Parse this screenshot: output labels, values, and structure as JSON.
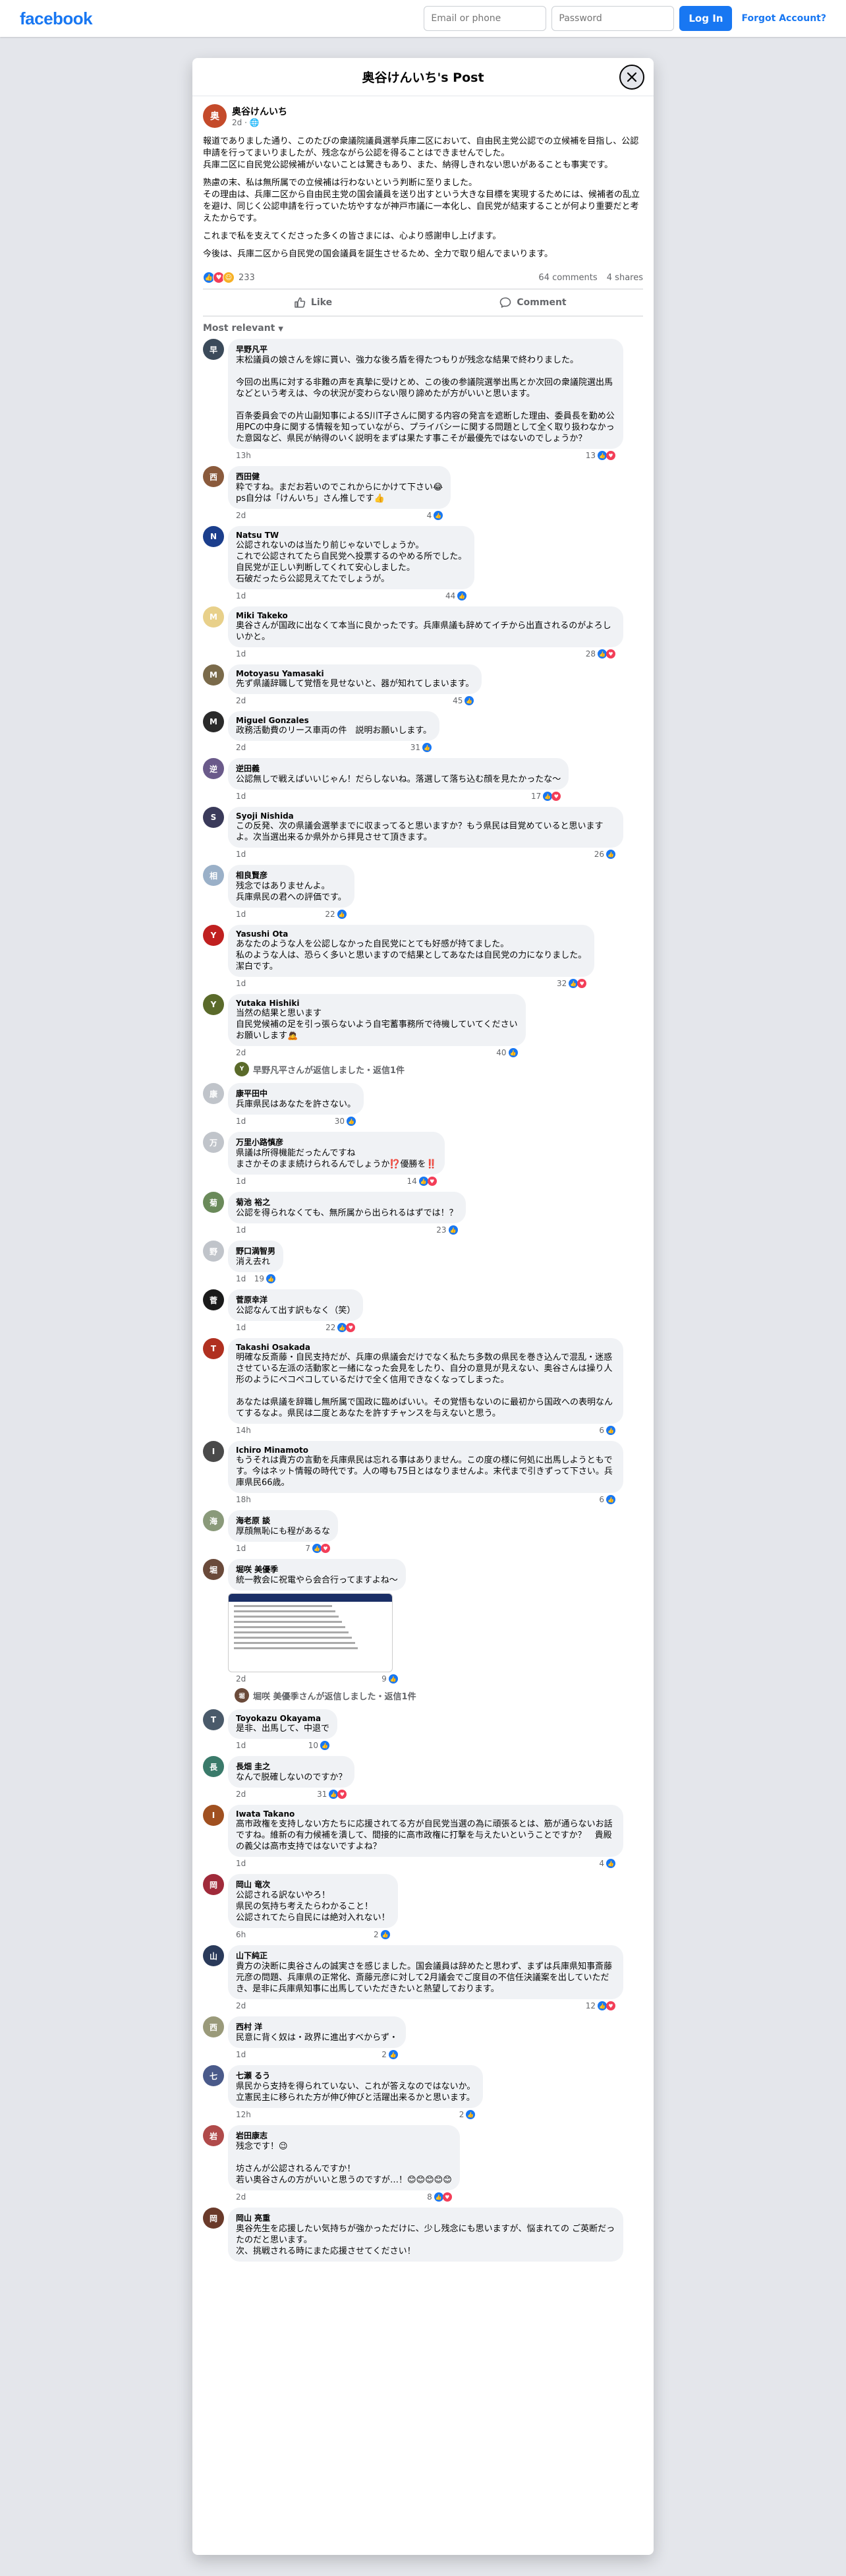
{
  "topbar": {
    "logo": "facebook",
    "email_placeholder": "Email or phone",
    "password_placeholder": "Password",
    "login_label": "Log In",
    "forgot_label": "Forgot Account?"
  },
  "dialog": {
    "title": "奥谷けんいち's Post"
  },
  "post": {
    "author": "奥谷けんいち",
    "time": "2d · ",
    "paragraphs": [
      "報道でありました通り、このたびの衆議院議員選挙兵庫二区において、自由民主党公認での立候補を目指し、公認申請を行ってまいりましたが、残念ながら公認を得ることはできませんでした。\n兵庫二区に自民党公認候補がいないことは驚きもあり、また、納得しきれない思いがあることも事実です。",
      "熟慮の末、私は無所属での立候補は行わないという判断に至りました。\nその理由は、兵庫二区から自由民主党の国会議員を送り出すという大きな目標を実現するためには、候補者の乱立を避け、同じく公認申請を行っていた坊やすなが神戸市議に一本化し、自民党が結束することが何より重要だと考えたからです。",
      "これまで私を支えてくださった多くの皆さまには、心より感謝申し上げます。",
      "今後は、兵庫二区から自民党の国会議員を誕生させるため、全力で取り組んでまいります。"
    ],
    "reaction_count": "233",
    "comments_count": "64 comments",
    "shares_count": "4 shares",
    "like_label": "Like",
    "comment_label": "Comment",
    "sort_label": "Most relevant"
  },
  "comments": [
    {
      "name": "早野凡平",
      "text": "末松議員の娘さんを嫁に貰い、強力な後ろ盾を得たつもりが残念な結果で終わりました。\n\n今回の出馬に対する非難の声を真摯に受けとめ、この後の参議院選挙出馬とか次回の衆議院選出馬などという考えは、今の状況が変わらない限り諦めたが方がいいと思います。\n\n百条委員会での片山副知事によるS川T子さんに関する内容の発言を遮断した理由、委員長を勤め公用PCの中身に関する情報を知っていながら、プライバシーに関する問題として全く取り扱わなかった意図など、県民が納得のいく説明をまずは果たす事こそが最優先ではないのでしょうか？",
      "time": "13h",
      "count": "13",
      "color": "#3b4a5a"
    },
    {
      "name": "西田健",
      "text": "粋ですね。まだお若いのでこれからにかけて下さい😂\nps自分は「けんいち」さん推しです👍",
      "time": "2d",
      "count": "4",
      "color": "#8a5a3c"
    },
    {
      "name": "Natsu TW",
      "text": "公認されないのは当たり前じゃないでしょうか。\nこれで公認されてたら自民党へ投票するのやめる所でした。\n自民党が正しい判断してくれて安心しました。\n石破だったら公認見えてたでしょうが。",
      "time": "1d",
      "count": "44",
      "color": "#1b3e8c"
    },
    {
      "name": "Miki Takeko",
      "text": "奥谷さんが国政に出なくて本当に良かったです。兵庫県議も辞めてイチから出直されるのがよろしいかと。",
      "time": "1d",
      "count": "28",
      "color": "#e8d08a"
    },
    {
      "name": "Motoyasu Yamasaki",
      "text": "先ず県議辞職して覚悟を見せないと、器が知れてしまいます。",
      "time": "2d",
      "count": "45",
      "color": "#7a6a4a"
    },
    {
      "name": "Miguel Gonzales",
      "text": "政務活動費のリース車両の件　説明お願いします。",
      "time": "2d",
      "count": "31",
      "color": "#2a2a2a"
    },
    {
      "name": "逆田義",
      "text": "公認無しで戦えばいいじゃん！だらしないね。落選して落ち込む顔を見たかったな〜",
      "time": "1d",
      "count": "17",
      "color": "#6a5a8a"
    },
    {
      "name": "Syoji Nishida",
      "text": "この反発、次の県議会選挙までに収まってると思いますか？もう県民は目覚めていると思いますよ。次当選出来るか県外から拝見させて頂きます。",
      "time": "1d",
      "count": "26",
      "color": "#3a3a5a"
    },
    {
      "name": "相良賢彦",
      "text": "残念ではありませんよ。\n兵庫県民の君への評価です。",
      "time": "1d",
      "count": "22",
      "color": "#9ab0c8"
    },
    {
      "name": "Yasushi Ota",
      "text": "あなたのような人を公認しなかった自民党にとても好感が持てました。\n私のような人は、恐らく多いと思いますので結果としてあなたは自民党の力になりました。\n潔白です。",
      "time": "1d",
      "count": "32",
      "color": "#c02020"
    },
    {
      "name": "Yutaka Hishiki",
      "text": "当然の結果と思います\n自民党候補の足を引っ張らないよう自宅蓄事務所で待機していてください\nお願いします🙇",
      "time": "2d",
      "count": "40",
      "color": "#5a6a2a"
    },
    {
      "name": "康平田中",
      "text": "兵庫県民はあなたを許さない。",
      "time": "1d",
      "count": "30",
      "color": "#c0c4ca"
    },
    {
      "name": "万里小路慎彦",
      "text": "県議は所得機能だったんですね\nまさかそのまま続けられるんでしょうか⁉️優勝を‼️",
      "time": "1d",
      "count": "14",
      "color": "#c0c4ca"
    },
    {
      "name": "菊池 裕之",
      "text": "公認を得られなくても、無所属から出られるはずでは！？",
      "time": "1d",
      "count": "23",
      "color": "#6a8a5a"
    },
    {
      "name": "野口満智男",
      "text": "消え去れ",
      "time": "1d",
      "count": "19",
      "color": "#c0c4ca"
    },
    {
      "name": "菅原幸洋",
      "text": "公認なんて出す訳もなく（笑）",
      "time": "1d",
      "count": "22",
      "color": "#1a1a1a"
    },
    {
      "name": "Takashi Osakada",
      "text": "明確な反斎藤・自民支持だが、兵庫の県議会だけでなく私たち多数の県民を巻き込んで混乱・迷惑させている左派の活動家と一緒になった会見をしたり、自分の意見が見えない、奥谷さんは操り人形のようにペコペコしているだけで全く信用できなくなってしまった。\n\nあなたは県議を辞職し無所属で国政に臨めばいい。その覚悟もないのに最初から国政への表明なんてするなよ。県民は二度とあなたを許すチャンスを与えないと思う。",
      "time": "14h",
      "count": "6",
      "color": "#b03020"
    },
    {
      "name": "Ichiro Minamoto",
      "text": "もうそれは貴方の言動を兵庫県民は忘れる事はありません。この度の様に何処に出馬しようともです。今はネット情報の時代です。人の噂も75日とはなりませんよ。末代まで引きずって下さい。兵庫県民66歳。",
      "time": "18h",
      "count": "6",
      "color": "#4a4a4a"
    },
    {
      "name": "海老原 談",
      "text": "厚顔無恥にも程があるな",
      "time": "1d",
      "count": "7",
      "color": "#8a9a7a"
    },
    {
      "name": "堀咲 美優季",
      "text": "統一教会に祝電やら会合行ってますよね〜",
      "time": "2d",
      "count": "9",
      "color": "#6a4a3a"
    },
    {
      "name": "Toyokazu Okayama",
      "text": "是非、出馬して、中退で",
      "time": "1d",
      "count": "10",
      "color": "#4a5a6a"
    },
    {
      "name": "長畑 圭之",
      "text": "なんで脱確しないのですか？",
      "time": "2d",
      "count": "31",
      "color": "#3a7a6a"
    },
    {
      "name": "Iwata Takano",
      "text": "高市政権を支持しない方たちに応援されてる方が自民党当選の為に頑張るとは、筋が通らないお話ですね。維新の有力候補を潰して、間接的に高市政権に打撃を与えたいということですか？　貴殿の義父は高市支持ではないですよね？",
      "time": "1d",
      "count": "4",
      "color": "#a05020"
    },
    {
      "name": "岡山 竜次",
      "text": "公認される訳ないやろ！\n県民の気持ち考えたらわかること！\n公認されてたら自民には絶対入れない！",
      "time": "6h",
      "count": "2",
      "color": "#a02a3a"
    },
    {
      "name": "山下純正",
      "text": "貴方の決断に奥谷さんの誠実さを感じました。国会議員は辞めたと思わず、まずは兵庫県知事斎藤元彦の問題、兵庫県の正常化、斎藤元彦に対して2月議会でご度目の不信任決議案を出していただき、是非に兵庫県知事に出馬していただきたいと熱望しております。",
      "time": "2d",
      "count": "12",
      "color": "#2a3a5a"
    },
    {
      "name": "西村 洋",
      "text": "民意に背く奴は・政界に進出すべからず・",
      "time": "1d",
      "count": "2",
      "color": "#9a9a7a"
    },
    {
      "name": "七瀬 るう",
      "text": "県民から支持を得られていない、これが答えなのではないか。\n立憲民主に移られた方が伸び伸びと活躍出来るかと思います。",
      "time": "12h",
      "count": "2",
      "color": "#4a5a8a"
    },
    {
      "name": "岩田康志",
      "text": "残念です！😉\n\n坊さんが公認されるんですか！\n若い奥谷さんの方がいいと思うのですが…！😊😊😊😊😊",
      "time": "2d",
      "count": "8",
      "color": "#b04a4a"
    },
    {
      "name": "岡山 亮重",
      "text": "奥谷先生を応援したい気持ちが強かっただけに、少し残念にも思いますが、悩まれての ご英断だったのだと思います。\n次、挑戦される時にまた応援させてください！",
      "time": "",
      "count": "",
      "color": "#6a3a2a"
    }
  ],
  "replies": {
    "c10": "早野凡平さんが返信しました・返信1件",
    "c19": "堀咲 美優季さんが返信しました・返信1件"
  }
}
